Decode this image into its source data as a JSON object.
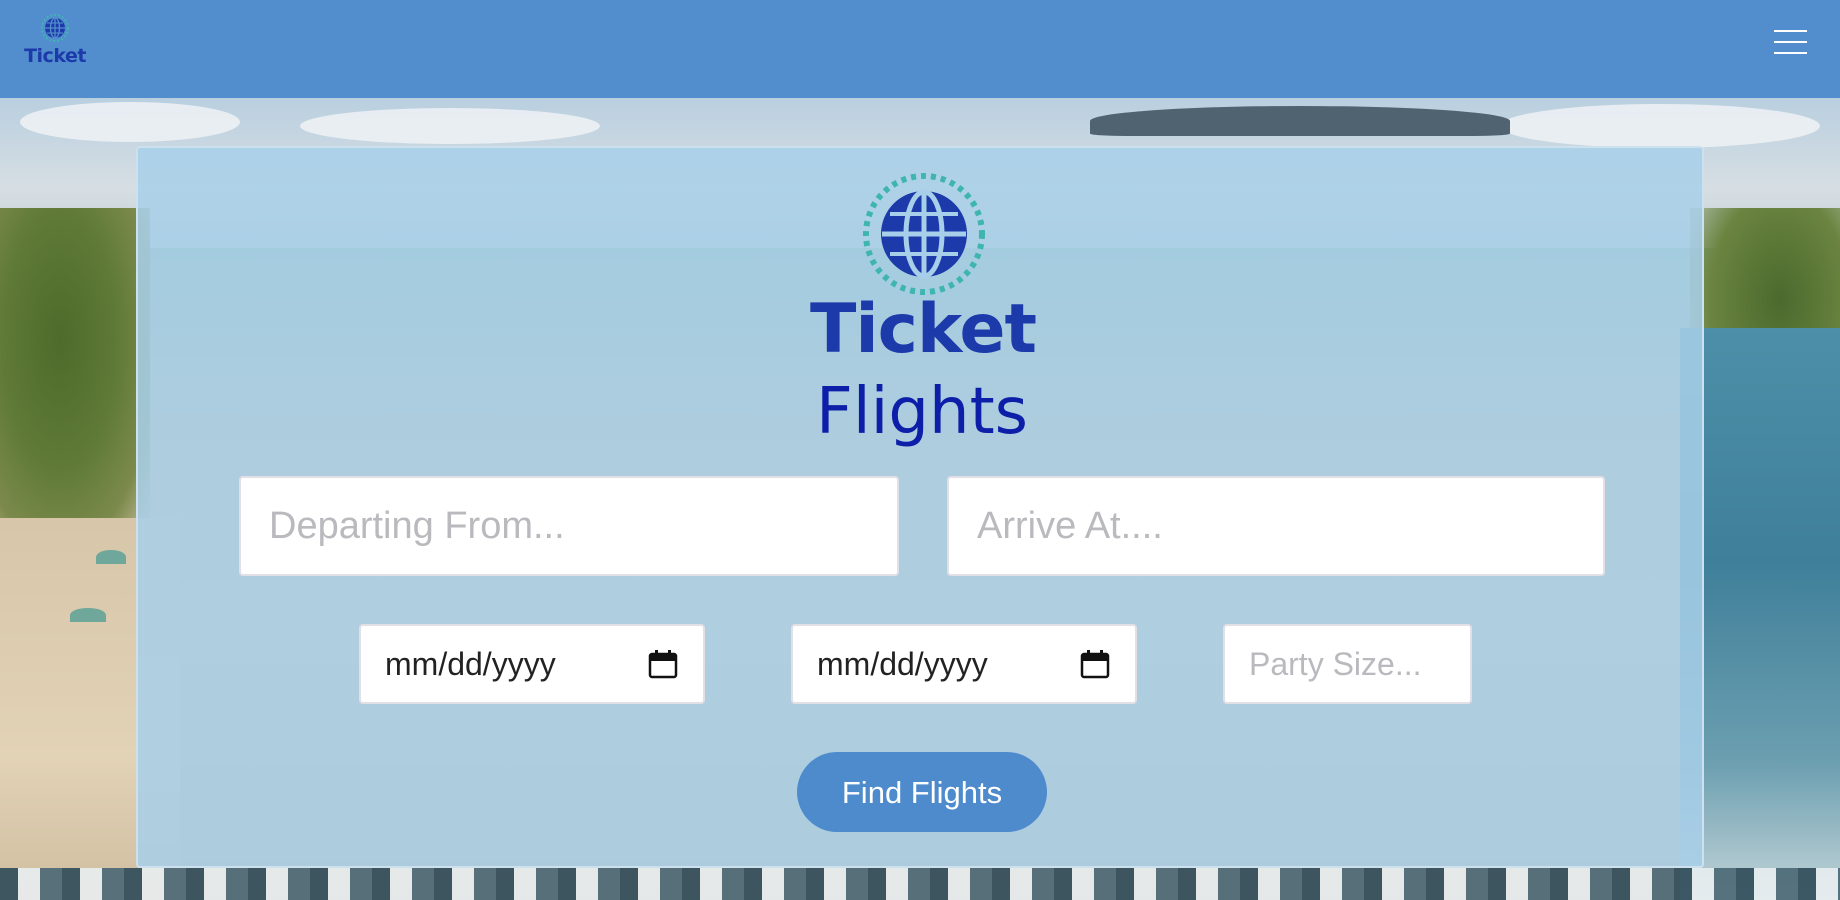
{
  "header": {
    "logo_text": "Ticket",
    "menu_icon": "hamburger-menu-icon",
    "background_color": "#528ecd"
  },
  "hero": {
    "logo_icon": "globe-icon",
    "logo_text": "Ticket",
    "title": "Flights"
  },
  "search": {
    "departing_placeholder": "Departing From...",
    "arrive_placeholder": "Arrive At....",
    "departure_date": "mm/dd/yyyy",
    "return_date": "mm/dd/yyyy",
    "calendar_icon": "calendar-icon",
    "party_size_placeholder": "Party Size...",
    "submit_label": "Find Flights"
  },
  "colors": {
    "brand_text": "#1c3aa9",
    "title_text": "#0d1fa8",
    "button": "#4d8bcc",
    "panel": "#a8cfe9",
    "ring_accent": "#3fb5b0"
  }
}
